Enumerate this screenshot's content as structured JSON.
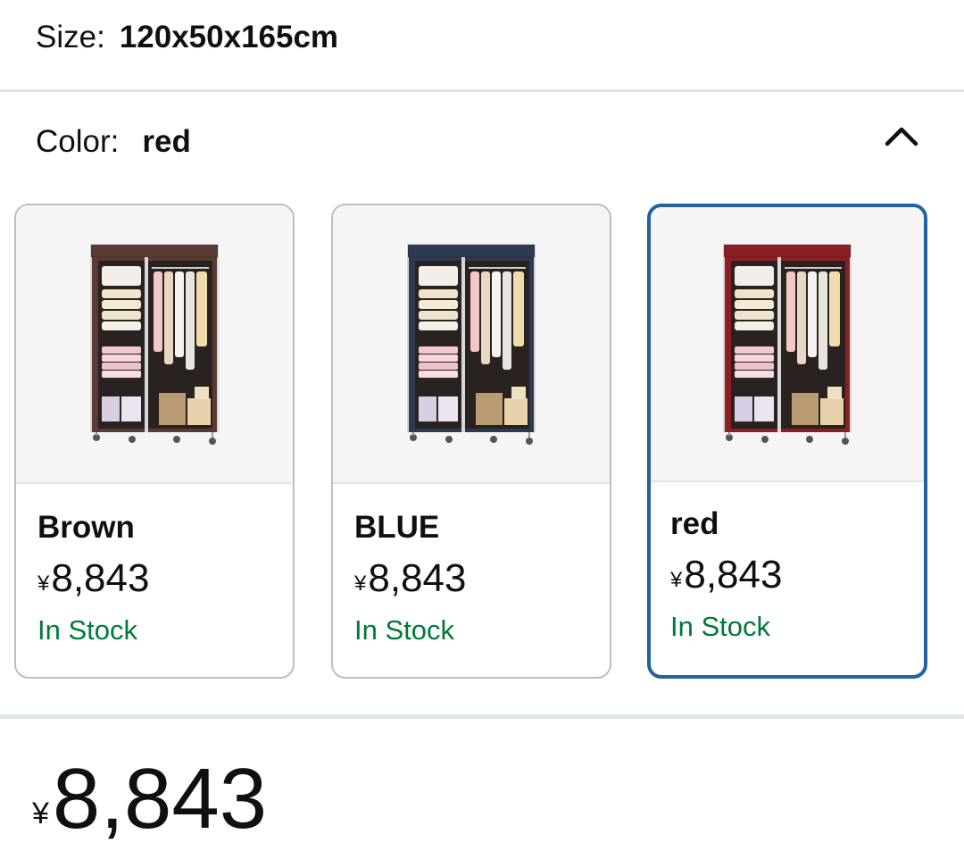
{
  "size": {
    "label": "Size:",
    "value": "120x50x165cm"
  },
  "color": {
    "label": "Color:",
    "value": "red"
  },
  "variants": [
    {
      "name": "Brown",
      "currency": "¥",
      "price": "8,843",
      "stock": "In Stock",
      "shade": "#5b3a33",
      "selected": false
    },
    {
      "name": "BLUE",
      "currency": "¥",
      "price": "8,843",
      "stock": "In Stock",
      "shade": "#2d3a52",
      "selected": false
    },
    {
      "name": "red",
      "currency": "¥",
      "price": "8,843",
      "stock": "In Stock",
      "shade": "#8a1f24",
      "selected": true
    }
  ],
  "total": {
    "currency": "¥",
    "amount": "8,843"
  },
  "icons": {
    "toggle": "chevron-up-icon"
  },
  "colors": {
    "accent": "#2162a1",
    "stock": "#007a37"
  }
}
